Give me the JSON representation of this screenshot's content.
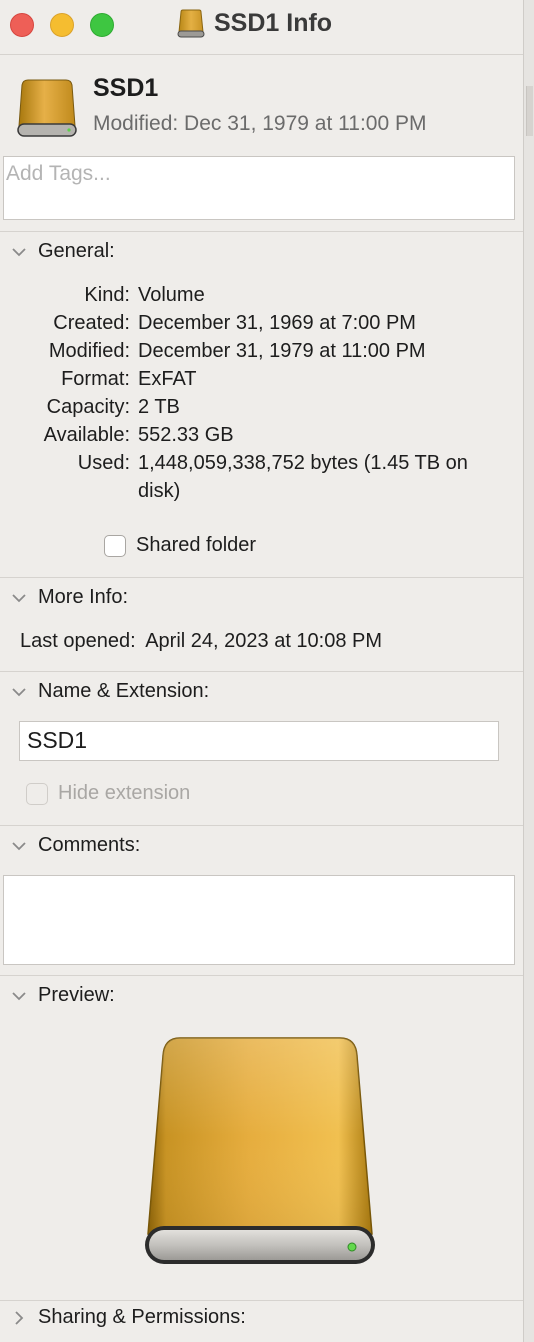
{
  "window": {
    "title": "SSD1 Info",
    "controls": [
      "close-button",
      "minimize-button",
      "zoom-button"
    ]
  },
  "header": {
    "name": "SSD1",
    "modified": "Modified: Dec 31, 1979 at 11:00 PM"
  },
  "tags": {
    "placeholder": "Add Tags..."
  },
  "general": {
    "title": "General:",
    "rows": [
      {
        "key": "Kind:",
        "value": "Volume"
      },
      {
        "key": "Created:",
        "value": "December 31, 1969 at 7:00 PM"
      },
      {
        "key": "Modified:",
        "value": "December 31, 1979 at 11:00 PM"
      },
      {
        "key": "Format:",
        "value": "ExFAT"
      },
      {
        "key": "Capacity:",
        "value": "2 TB"
      },
      {
        "key": "Available:",
        "value": "552.33 GB"
      },
      {
        "key": "Used:",
        "value": "1,448,059,338,752 bytes (1.45 TB on disk)"
      }
    ],
    "shared_folder_label": "Shared folder",
    "shared_folder_checked": false
  },
  "more_info": {
    "title": "More Info:",
    "last_opened_key": "Last opened:",
    "last_opened_value": "April 24, 2023 at 10:08 PM"
  },
  "name_extension": {
    "title": "Name & Extension:",
    "name_value": "SSD1",
    "hide_extension_label": "Hide extension",
    "hide_extension_checked": false,
    "hide_extension_enabled": false
  },
  "comments": {
    "title": "Comments:",
    "value": ""
  },
  "preview": {
    "title": "Preview:",
    "icon": "external-drive-icon"
  },
  "sharing": {
    "title": "Sharing & Permissions:"
  },
  "colors": {
    "drive_gold": "#e0a73a",
    "window_bg": "#efedea",
    "close": "#ee5f57",
    "minimize": "#f5bd30",
    "zoom": "#3ec641"
  }
}
